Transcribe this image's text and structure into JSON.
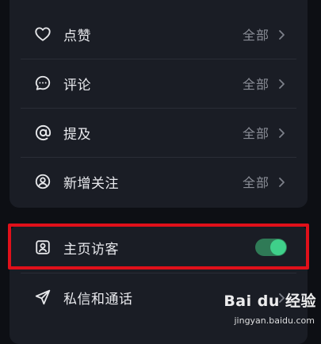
{
  "notifications": [
    {
      "id": "like",
      "label": "点赞",
      "value": "全部",
      "icon": "heart-icon"
    },
    {
      "id": "comment",
      "label": "评论",
      "value": "全部",
      "icon": "chat-bubble-icon"
    },
    {
      "id": "mention",
      "label": "提及",
      "value": "全部",
      "icon": "at-sign-icon"
    },
    {
      "id": "new-follow",
      "label": "新增关注",
      "value": "全部",
      "icon": "user-circle-icon"
    }
  ],
  "visitors": {
    "label": "主页访客",
    "icon": "profile-card-icon",
    "toggle_on": true
  },
  "messages": {
    "label": "私信和通话",
    "icon": "paper-plane-icon"
  },
  "watermark": {
    "brand": "Bai du 经验",
    "url": "jingyan.baidu.com"
  },
  "colors": {
    "background": "#0d0f14",
    "card": "#1a1d25",
    "toggle_active": "#3fd08a",
    "highlight_border": "#e0101a"
  }
}
